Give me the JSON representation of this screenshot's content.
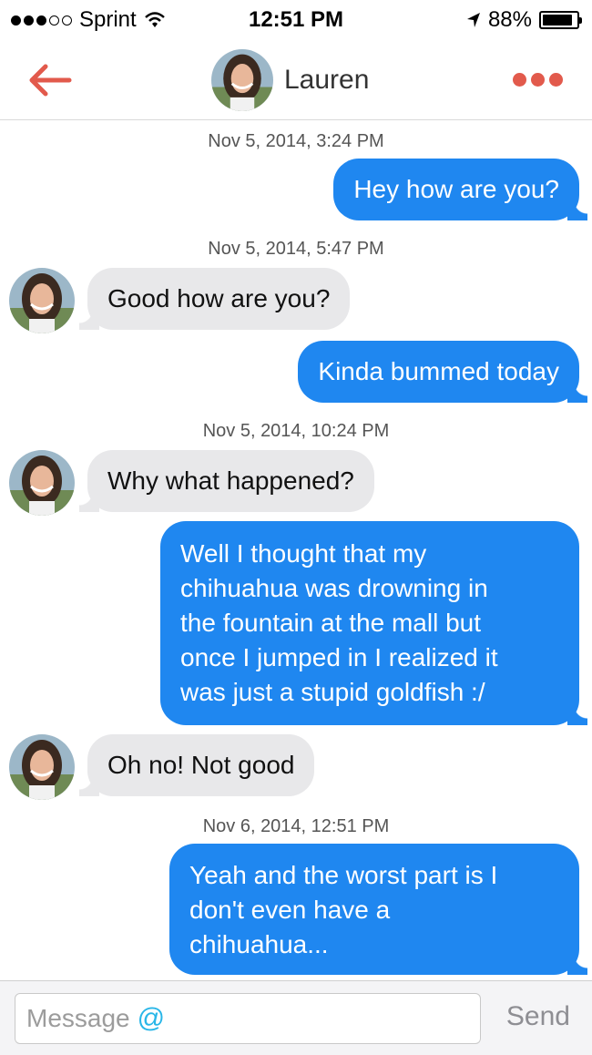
{
  "status_bar": {
    "carrier": "Sprint",
    "time": "12:51 PM",
    "battery": "88%",
    "battery_level": 0.88,
    "signal_filled": 3,
    "signal_empty": 2
  },
  "nav": {
    "contact_name": "Lauren",
    "back_icon": "arrow-left-icon",
    "more_icon": "more-dots-icon",
    "accent_color": "#e25a4c"
  },
  "conversation": {
    "ts1": "Nov 5, 2014, 3:24 PM",
    "m1": "Hey how are you?",
    "ts2": "Nov 5, 2014, 5:47 PM",
    "m2": "Good how are you?",
    "m3": "Kinda bummed today",
    "ts3": "Nov 5, 2014, 10:24 PM",
    "m4": "Why what happened?",
    "m5": "Well I thought that my\nchihuahua was drowning in\nthe fountain at the mall but\nonce I jumped in I realized it\nwas just a stupid goldfish :/",
    "m6": "Oh no! Not good",
    "ts4": "Nov 6, 2014, 12:51 PM",
    "m7": "Yeah and the worst part is I\ndon't even have a\nchihuahua..."
  },
  "colors": {
    "outgoing_bubble": "#1f87f0",
    "incoming_bubble": "#e8e8ea"
  },
  "composer": {
    "placeholder": "Message",
    "mention_symbol": "@",
    "send_label": "Send"
  }
}
